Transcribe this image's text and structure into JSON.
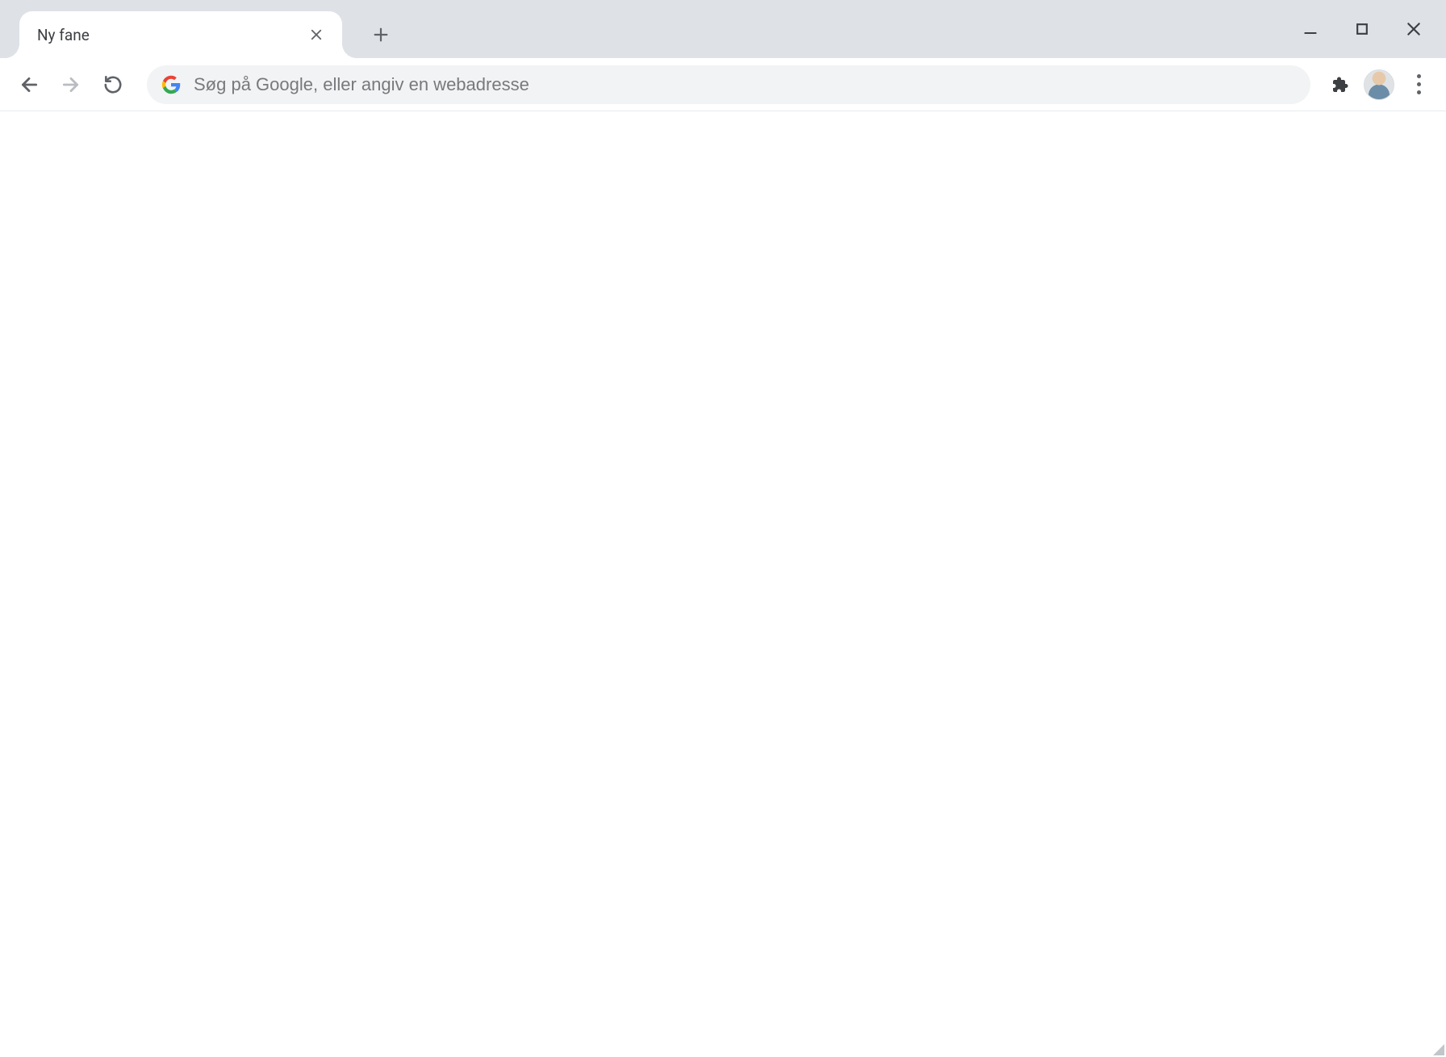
{
  "tabs": [
    {
      "title": "Ny fane"
    }
  ],
  "omnibox": {
    "placeholder": "Søg på Google, eller angiv en webadresse",
    "value": ""
  },
  "icons": {
    "close": "close-icon",
    "new_tab": "plus-icon",
    "minimize": "minimize-icon",
    "maximize": "maximize-icon",
    "window_close": "close-icon",
    "back": "arrow-left-icon",
    "forward": "arrow-right-icon",
    "reload": "reload-icon",
    "search_engine": "google-g-icon",
    "extensions": "puzzle-piece-icon",
    "menu": "kebab-menu-icon",
    "profile": "avatar"
  },
  "nav_state": {
    "back_enabled": true,
    "forward_enabled": false,
    "reload_enabled": true
  },
  "colors": {
    "tabstrip_bg": "#dee1e6",
    "toolbar_bg": "#ffffff",
    "omnibox_bg": "#f1f3f4",
    "text": "#3c4043",
    "placeholder": "#78797c"
  }
}
